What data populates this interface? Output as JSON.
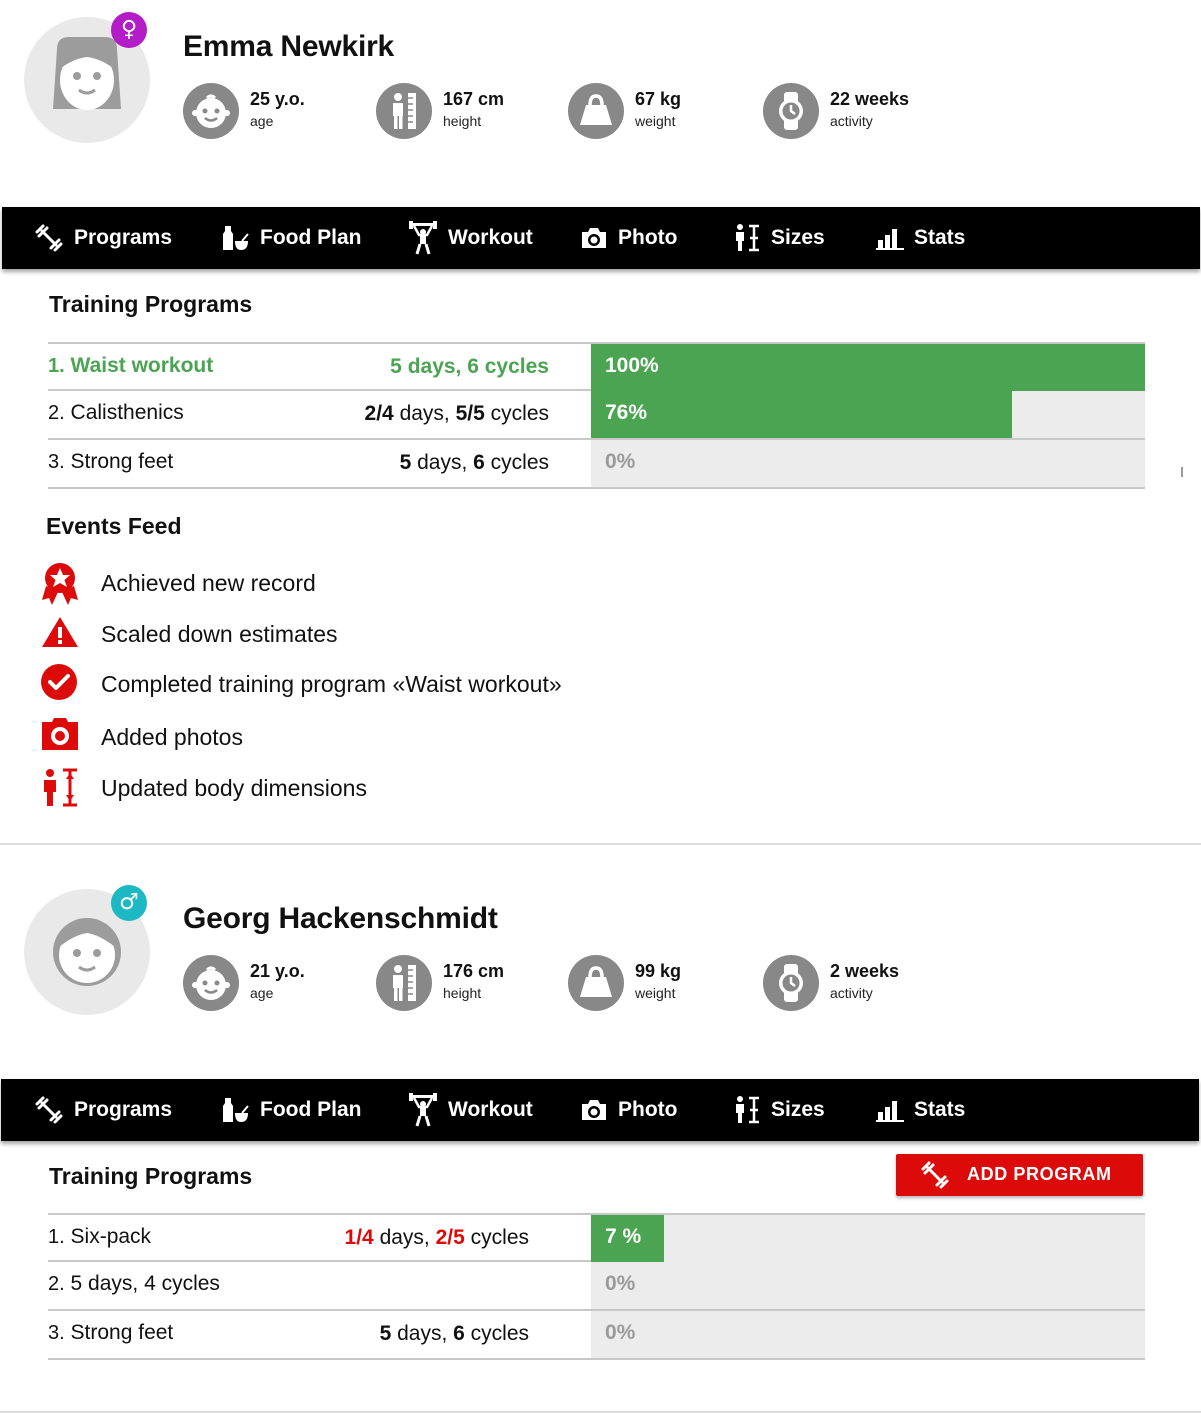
{
  "colors": {
    "accent_red": "#dd0a0a",
    "progress_green": "#4aa452",
    "female_badge": "#b31cc6",
    "male_badge": "#1cb8c4",
    "stat_icon_bg": "#888888"
  },
  "profiles": [
    {
      "name": "Emma Newkirk",
      "gender_symbol": "♀",
      "stats": [
        {
          "icon": "baby-face-icon",
          "value": "25 y.o.",
          "label": "age"
        },
        {
          "icon": "height-ruler-icon",
          "value": "167 cm",
          "label": "height"
        },
        {
          "icon": "weight-icon",
          "value": "67 kg",
          "label": "weight"
        },
        {
          "icon": "watch-icon",
          "value": "22 weeks",
          "label": "activity"
        }
      ],
      "nav": [
        {
          "icon": "dumbbell-icon",
          "label": "Programs"
        },
        {
          "icon": "food-icon",
          "label": "Food Plan"
        },
        {
          "icon": "weightlifter-icon",
          "label": "Workout"
        },
        {
          "icon": "camera-icon",
          "label": "Photo"
        },
        {
          "icon": "body-size-icon",
          "label": "Sizes"
        },
        {
          "icon": "bar-chart-icon",
          "label": "Stats"
        }
      ],
      "programs_title": "Training Programs",
      "programs": [
        {
          "num": "1.",
          "name": "Waist workout",
          "days": "5",
          "days_text": " days, ",
          "cycles": "6",
          "cycles_text": " cycles",
          "progress": 1.0,
          "pct_label": "100%"
        },
        {
          "num": "2.",
          "name": "Calisthenics",
          "days": "2/4",
          "days_text": " days, ",
          "cycles": "5/5",
          "cycles_text": " cycles",
          "progress": 0.76,
          "pct_label": "76%"
        },
        {
          "num": "3.",
          "name": "Strong feet",
          "days": "5",
          "days_text": " days, ",
          "cycles": "6",
          "cycles_text": " cycles",
          "progress": 0,
          "pct_label": "0%"
        }
      ],
      "events_title": "Events Feed",
      "events": [
        {
          "icon": "award-ribbon-icon",
          "text": "Achieved new record"
        },
        {
          "icon": "warning-icon",
          "text": "Scaled down estimates"
        },
        {
          "icon": "check-circle-icon",
          "text": "Completed training program «Waist workout»"
        },
        {
          "icon": "camera-icon",
          "text": "Added photos"
        },
        {
          "icon": "body-dimensions-icon",
          "text": "Updated body dimensions"
        }
      ]
    },
    {
      "name": "Georg Hackenschmidt",
      "gender_symbol": "♂",
      "stats": [
        {
          "icon": "baby-face-icon",
          "value": "21 y.o.",
          "label": "age"
        },
        {
          "icon": "height-ruler-icon",
          "value": "176 cm",
          "label": "height"
        },
        {
          "icon": "weight-icon",
          "value": "99 kg",
          "label": "weight"
        },
        {
          "icon": "watch-icon",
          "value": "2 weeks",
          "label": "activity"
        }
      ],
      "nav": [
        {
          "icon": "dumbbell-icon",
          "label": "Programs"
        },
        {
          "icon": "food-icon",
          "label": "Food Plan"
        },
        {
          "icon": "weightlifter-icon",
          "label": "Workout"
        },
        {
          "icon": "camera-icon",
          "label": "Photo"
        },
        {
          "icon": "body-size-icon",
          "label": "Sizes"
        },
        {
          "icon": "bar-chart-icon",
          "label": "Stats"
        }
      ],
      "programs_title": "Training Programs",
      "add_program_label": "ADD PROGRAM",
      "programs": [
        {
          "num": "1.",
          "name": "Six-pack",
          "days": "1/4",
          "days_text": " days, ",
          "cycles": "2/5",
          "cycles_text": " cycles",
          "progress": 0.07,
          "pct_label": "7 %"
        },
        {
          "num": "2.",
          "name": "5 days, 4 cycles",
          "days": "",
          "days_text": "",
          "cycles": "",
          "cycles_text": "",
          "progress": 0,
          "pct_label": "0%"
        },
        {
          "num": "3.",
          "name": "Strong feet",
          "days": "5",
          "days_text": " days, ",
          "cycles": "6",
          "cycles_text": " cycles",
          "progress": 0,
          "pct_label": "0%"
        }
      ]
    }
  ]
}
